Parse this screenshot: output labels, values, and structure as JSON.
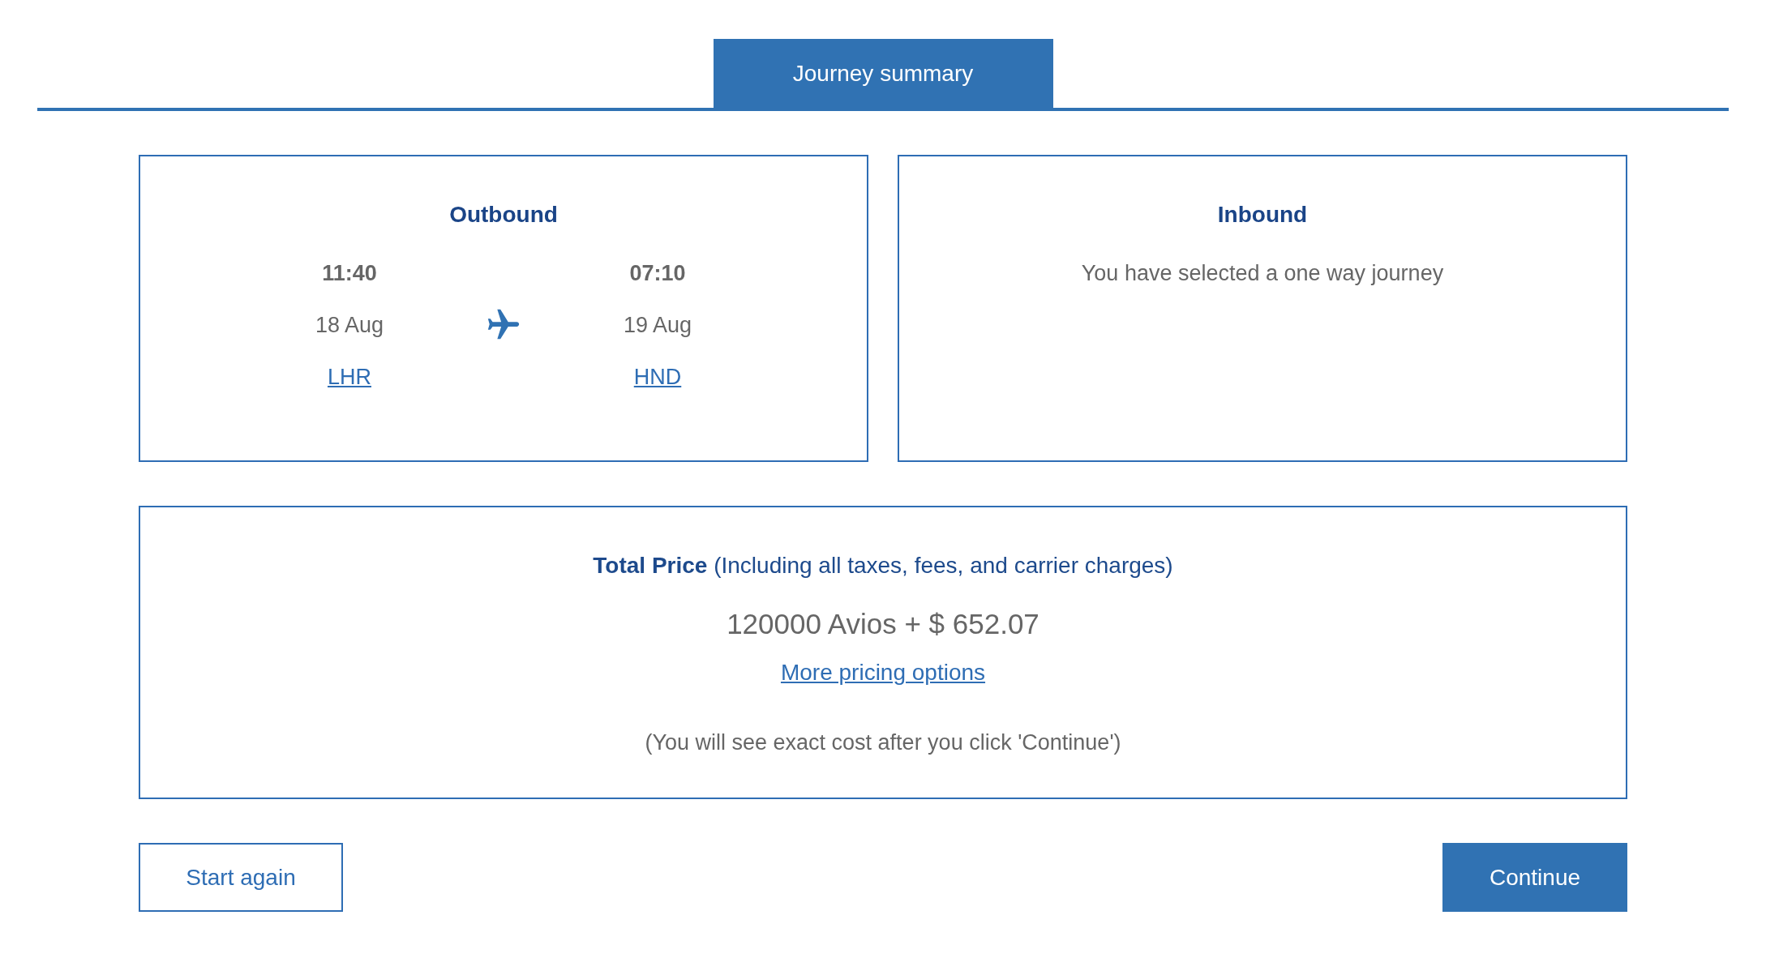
{
  "tab": {
    "label": "Journey summary",
    "selected": true
  },
  "outbound": {
    "title": "Outbound",
    "legs": [
      {
        "time": "11:40",
        "date": "18 Aug",
        "airport": "LHR"
      },
      {
        "time": "07:10",
        "date": "19 Aug",
        "airport": "HND"
      }
    ]
  },
  "inbound": {
    "title": "Inbound",
    "message": "You have selected a one way journey"
  },
  "price": {
    "label": "**Total Price** (Including all taxes, fees, and carrier charges)",
    "amount": "120000 Avios + $ 652.07",
    "link": "More pricing options",
    "footnote": "(You will see exact cost after you click 'Continue')"
  },
  "buttons": [
    {
      "label": "Start again",
      "kind": "secondary"
    },
    {
      "label": "Continue",
      "kind": "primary"
    }
  ]
}
